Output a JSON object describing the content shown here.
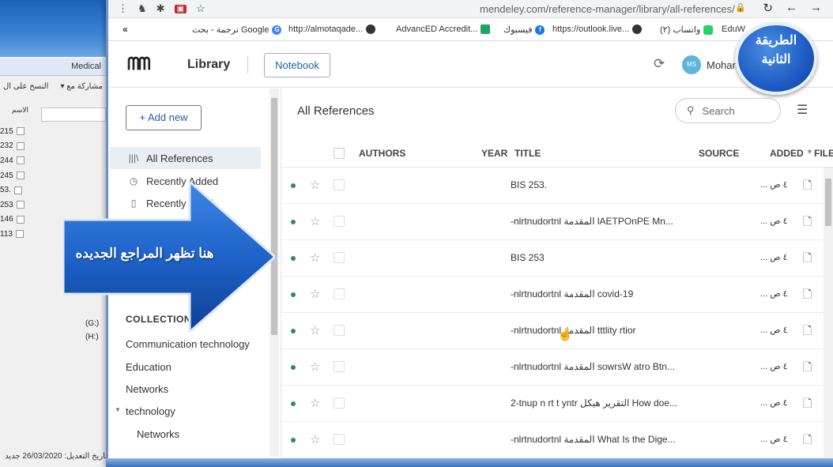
{
  "background_app": {
    "tab_label": "Medical",
    "toolbar_left": "النسخ على ال",
    "toolbar_right": "مشاركة مع ▾",
    "column_header": "الاسم",
    "file_numbers": [
      "215",
      "232",
      "244",
      "245",
      "53.",
      "253",
      "146",
      "113"
    ],
    "drives": [
      "(G:)",
      "(H:)"
    ],
    "bottom_text": "تاريخ التعديل: 26/03/2020 جديد"
  },
  "browser": {
    "url": "mendeley.com/reference-manager/library/all-references/",
    "bookmarks": [
      {
        "label": "ترجمة - بحث Google",
        "icon": "G"
      },
      {
        "label": "http://almotaqade...",
        "icon": ""
      },
      {
        "label": "AdvancED Accredit...",
        "icon": ""
      },
      {
        "label": "فيسبوك",
        "icon": "f"
      },
      {
        "label": "https://outlook.live...",
        "icon": ""
      },
      {
        "label": "(٢) واتساب",
        "icon": ""
      },
      {
        "label": "EduW",
        "icon": ""
      }
    ]
  },
  "header": {
    "logo": "M",
    "title": "Library",
    "notebook_label": "Notebook",
    "avatar_initials": "MS",
    "user_name": "Mohan"
  },
  "sidebar": {
    "add_new_label": "+ Add new",
    "nav": [
      {
        "label": "All References",
        "icon": "|||\\"
      },
      {
        "label": "Recently Added",
        "icon": "◷"
      },
      {
        "label": "Recently Read",
        "icon": "▯"
      }
    ],
    "collections_heading": "COLLECTIONS",
    "collections": [
      "Communication technology",
      "Education",
      "Networks",
      "technology",
      "Networks"
    ]
  },
  "main": {
    "title": "All References",
    "search_placeholder": "Search",
    "columns": {
      "authors": "AUTHORS",
      "year": "YEAR",
      "title": "TITLE",
      "source": "SOURCE",
      "added": "ADDED",
      "files": "FILE"
    },
    "rows": [
      {
        "title": "BIS 253.",
        "added": "٤ ص ..."
      },
      {
        "title": "-nlrtnudortnl المقدمة lAETPOnPE Mn...",
        "added": "٤ ص ..."
      },
      {
        "title": "BIS 253",
        "added": "٤ ص ..."
      },
      {
        "title": "-nlrtnudortnl المقدمة covid-19",
        "added": "٤ ص ..."
      },
      {
        "title": "-nlrtnudortnl المقدمة tttlity rtior",
        "added": "٤ ص ..."
      },
      {
        "title": "-nlrtnudortnl المقدمة sowrsW atro Btn...",
        "added": "٤ ص ..."
      },
      {
        "title": "2-tnup n rt t yntr التقرير هيكل How doe...",
        "added": "٤ ص ..."
      },
      {
        "title": "-nlrtnudortnl المقدمة What Is the Dige...",
        "added": "٤ ص ..."
      }
    ]
  },
  "overlays": {
    "arrow_text": "هنا تظهر المراجع الجديده",
    "badge_text": "الطريقة\nالثانية"
  },
  "colors": {
    "accent_blue": "#1f5fa8",
    "arrow_blue": "#1e63c9",
    "dot_green": "#2e8b57"
  }
}
